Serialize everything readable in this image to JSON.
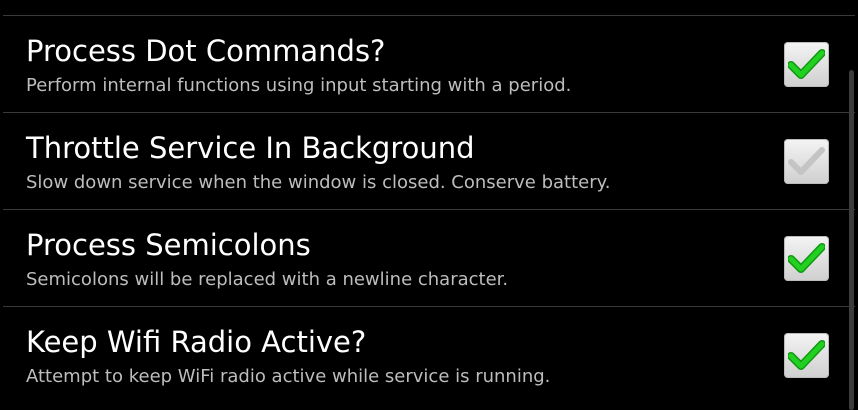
{
  "preferences": [
    {
      "title": "Process Dot Commands?",
      "summary": "Perform internal functions using input starting with a period.",
      "checked": true,
      "enabled": true
    },
    {
      "title": "Throttle Service In Background",
      "summary": "Slow down service when the window is closed. Conserve battery.",
      "checked": true,
      "enabled": false
    },
    {
      "title": "Process Semicolons",
      "summary": "Semicolons will be replaced with a newline character.",
      "checked": true,
      "enabled": true
    },
    {
      "title": "Keep Wifi Radio Active?",
      "summary": "Attempt to keep WiFi radio active while service is running.",
      "checked": true,
      "enabled": true
    }
  ],
  "colors": {
    "check_enabled": "#22c322",
    "check_disabled": "#c8c8c8"
  }
}
